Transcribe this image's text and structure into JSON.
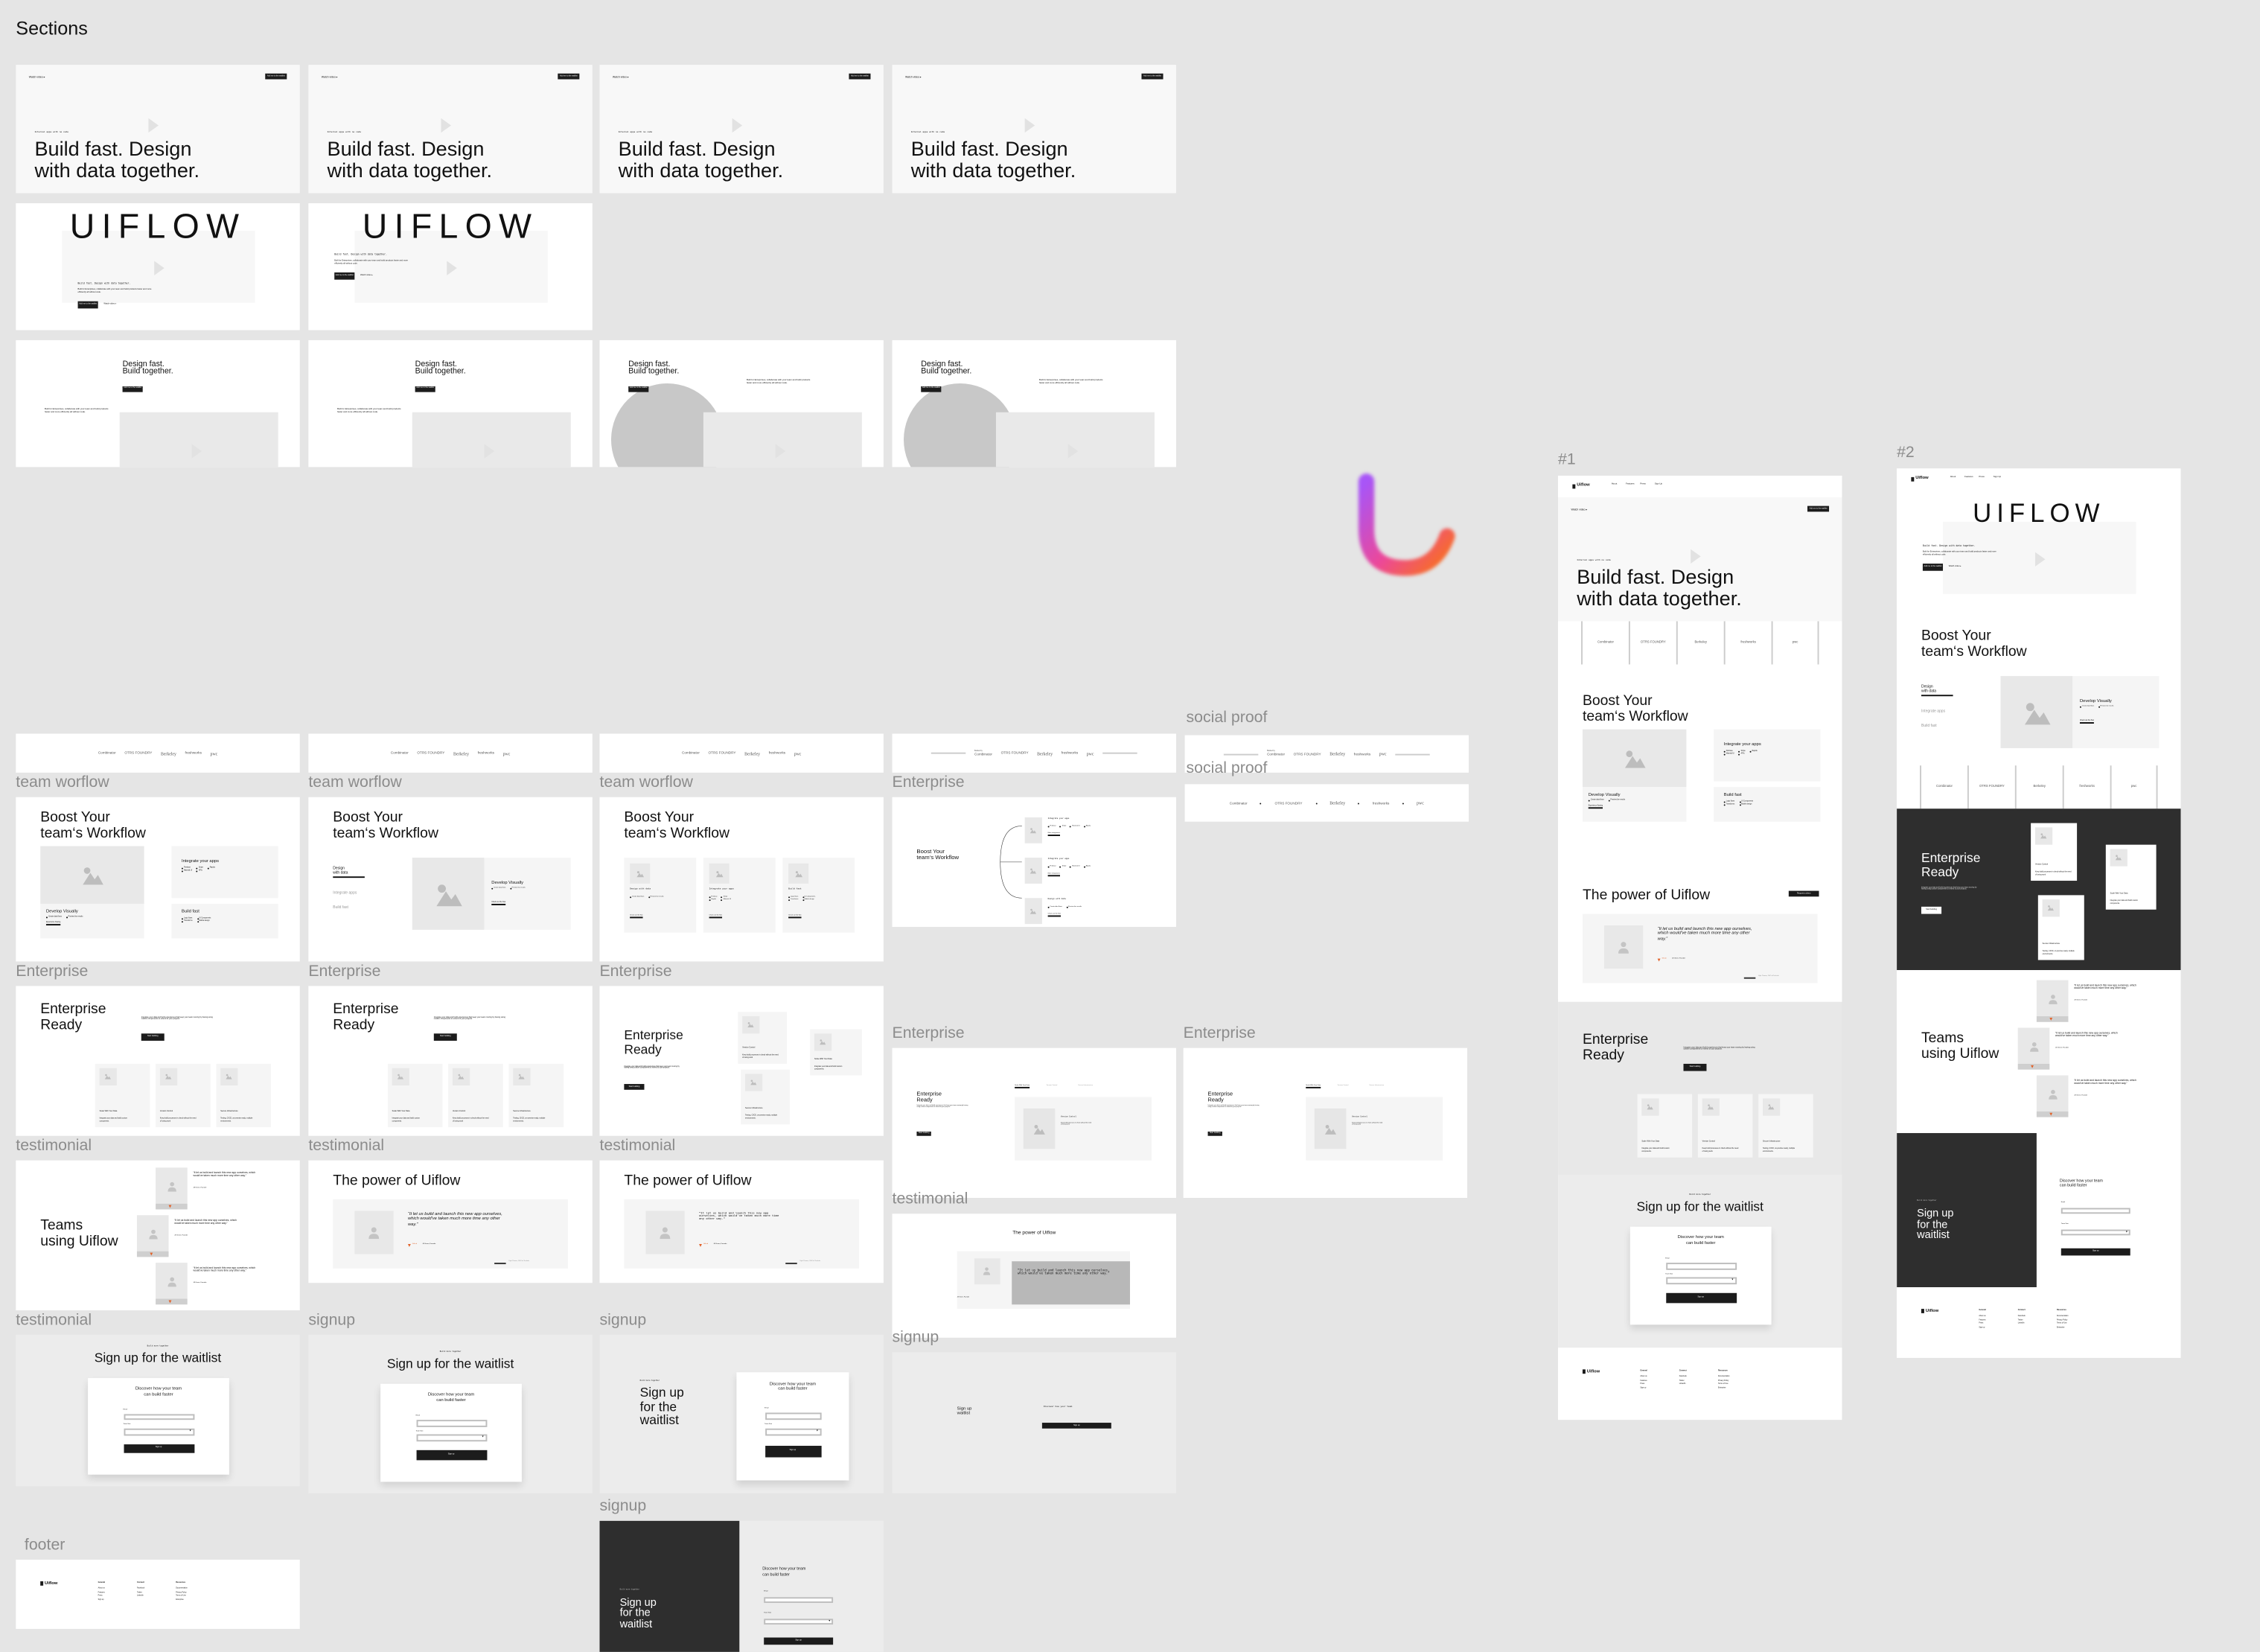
{
  "canvas": {
    "title": "Sections",
    "labels": {
      "team_workflow": "team worflow",
      "enterprise": "Enterprise",
      "testimonial": "testimonial",
      "signup": "signup",
      "footer": "footer",
      "social_proof": "social proof",
      "frame_1": "#1",
      "frame_2": "#2"
    },
    "colors": {
      "background": "#e5e5e5",
      "dark": "#2e2e2e",
      "accent_gradient": [
        "#a855f7",
        "#ec4899",
        "#f97316"
      ]
    }
  },
  "nav": {
    "brand": "Uiflow",
    "items": [
      "About",
      "Features",
      "Press",
      "Sign Up"
    ]
  },
  "hero": {
    "watch": "Watch video ▸",
    "cta": "Add me to the waitlist",
    "eyebrow": "Internal apps with no code",
    "title_1": "Build fast. Design",
    "title_2": "with data together."
  },
  "uiflow": {
    "brand": "UIFLOW",
    "tagline": "Build fast. Design with data together.",
    "body": "Built for Enterprises, collaborate with your team and build products faster and more efficiently all without code.",
    "cta": "Add me to the waitlist",
    "watch": "Watch video ▸"
  },
  "design": {
    "title_1": "Design fast.",
    "title_2": "Build together.",
    "cta": "Add me to the waitlist",
    "body": "Built for Enterprises, collaborate with your team and build products faster and more efficiently all without code."
  },
  "social": {
    "backed_by": "Backed by",
    "logos": [
      "Combinator",
      "OTRS FOUNDRY",
      "Berkeley",
      "freshworks",
      "pwc"
    ]
  },
  "workflow": {
    "title_1": "Boost Your",
    "title_2": "team‘s Workflow",
    "integrate": {
      "title": "Integrate your apps",
      "items": [
        "Firebase",
        "Stripe",
        "Rapids",
        "Material UI",
        "APIs"
      ]
    },
    "integrate_alt": {
      "items": [
        "Firebase",
        "Stripe",
        "Material UI",
        "Algolia"
      ],
      "link": "More integrations"
    },
    "develop": {
      "title": "Develop Visually",
      "items": [
        "Create data flows",
        "Preview live results"
      ],
      "link": "Experience flowing"
    },
    "build": {
      "title": "Build fast",
      "items": [
        "Logic flows",
        "UI Components",
        "Transforms",
        "Mobile design"
      ]
    },
    "tabs": [
      "Design",
      "with data",
      "Integrate apps",
      "Build fast"
    ],
    "design_with_data": "Design with data",
    "check_link": "Check out the flow"
  },
  "enterprise": {
    "title_1": "Enterprise",
    "title_2": "Ready",
    "body": "Integrate your data and build experiences that keep your team moving by having using custom components to extend to your projects.",
    "cta": "Start building",
    "cards": [
      {
        "title": "Scale With Your Data",
        "desc": "Integrate your data and build custom components."
      },
      {
        "title": "Version Control",
        "desc": "Keep build processes in check without the need of losing work"
      },
      {
        "title": "Secure Infrastructure",
        "desc": "Testing, CI/CD, on-premise ready, multiple environments."
      }
    ]
  },
  "testimonial": {
    "teams_1": "Teams",
    "teams_2": "using Uiflow",
    "quote": "“It let us build and launch this new app ourselves, which would've taken much more time any other way.”",
    "author": "Jill Green, Founder",
    "company": "GitLab",
    "power": "The power of Uiflow",
    "demo": "Request a demo",
    "caption": "Kyle Thorne, CEO of Techula"
  },
  "signup": {
    "eyebrow": "Build more together",
    "title": "Sign up for the waitlist",
    "title_lines": [
      "Sign up",
      "for the",
      "waitlist"
    ],
    "form_title_1": "Discover how your team",
    "form_title_2": "can build faster",
    "email_label": "Email",
    "email_value": "",
    "team_size_label": "Team Size",
    "team_size_value": "",
    "submit": "Sign up"
  },
  "footer": {
    "brand": "Uiflow",
    "columns": [
      {
        "heading": "General",
        "items": [
          "About us",
          "Features",
          "Press",
          "Sign up"
        ]
      },
      {
        "heading": "Connect",
        "items": [
          "Facebook",
          "Twitter",
          "LinkedIn"
        ]
      },
      {
        "heading": "Resources",
        "items": [
          "Documentation",
          "Privacy Policy",
          "Terms of Use",
          "Enterprise"
        ]
      }
    ]
  }
}
